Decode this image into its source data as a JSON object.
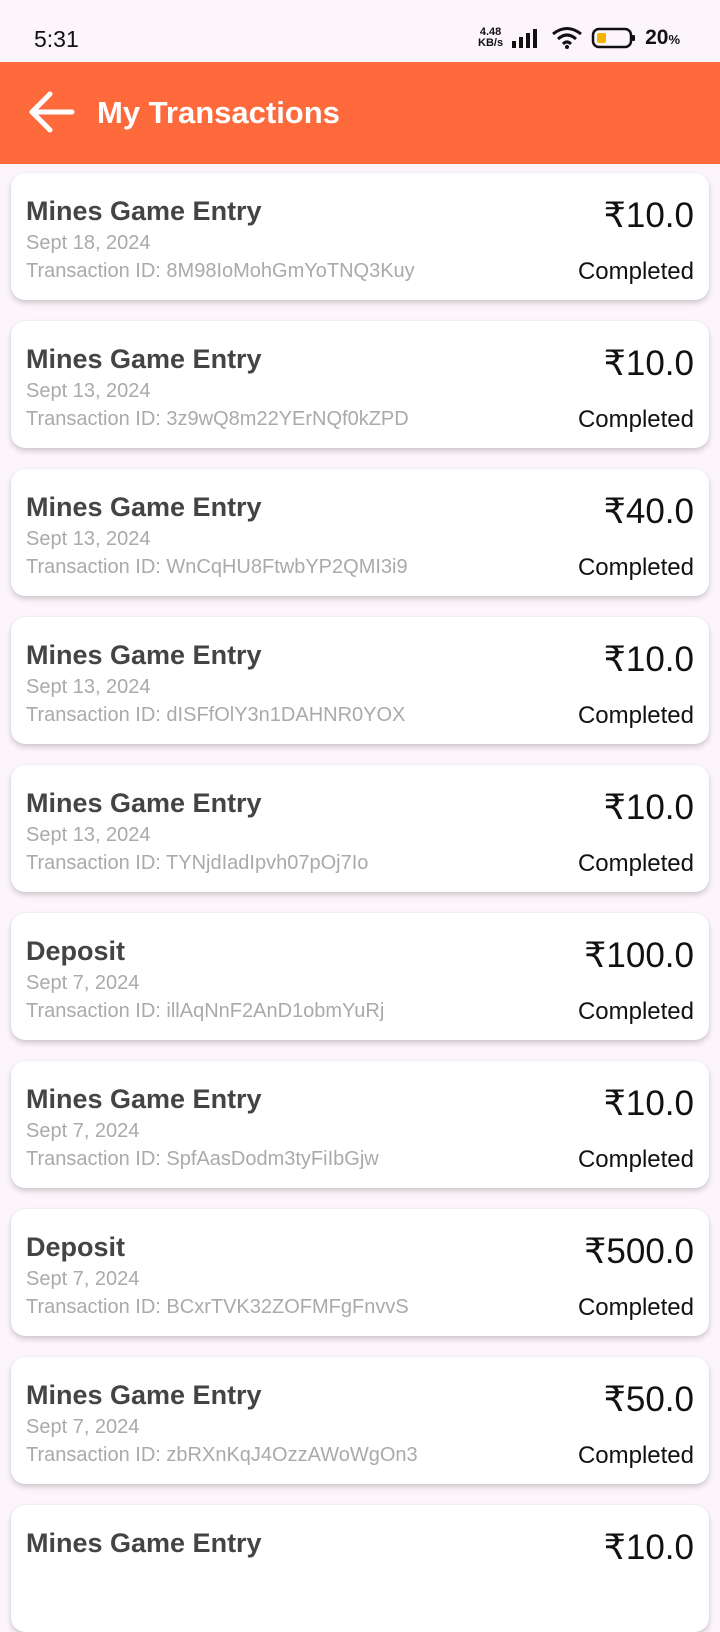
{
  "status_bar": {
    "time": "5:31",
    "net_speed_value": "4.48",
    "net_speed_unit": "KB/s",
    "battery_percent": "20",
    "battery_unit": "%",
    "icons": [
      "signal-icon",
      "wifi-icon",
      "battery-icon"
    ]
  },
  "app_bar": {
    "title": "My Transactions",
    "back_icon": "arrow-left-icon",
    "color": "#ff6a3d"
  },
  "transactions": [
    {
      "title": "Mines Game Entry",
      "date": "Sept 18, 2024",
      "txid": "Transaction ID: 8M98IoMohGmYoTNQ3Kuy",
      "amount": "₹10.0",
      "status": "Completed"
    },
    {
      "title": "Mines Game Entry",
      "date": "Sept 13, 2024",
      "txid": "Transaction ID: 3z9wQ8m22YErNQf0kZPD",
      "amount": "₹10.0",
      "status": "Completed"
    },
    {
      "title": "Mines Game Entry",
      "date": "Sept 13, 2024",
      "txid": "Transaction ID: WnCqHU8FtwbYP2QMI3i9",
      "amount": "₹40.0",
      "status": "Completed"
    },
    {
      "title": "Mines Game Entry",
      "date": "Sept 13, 2024",
      "txid": "Transaction ID: dISFfOlY3n1DAHNR0YOX",
      "amount": "₹10.0",
      "status": "Completed"
    },
    {
      "title": "Mines Game Entry",
      "date": "Sept 13, 2024",
      "txid": "Transaction ID: TYNjdIadIpvh07pOj7Io",
      "amount": "₹10.0",
      "status": "Completed"
    },
    {
      "title": "Deposit",
      "date": "Sept 7, 2024",
      "txid": "Transaction ID: illAqNnF2AnD1obmYuRj",
      "amount": "₹100.0",
      "status": "Completed"
    },
    {
      "title": "Mines Game Entry",
      "date": "Sept 7, 2024",
      "txid": "Transaction ID: SpfAasDodm3tyFiIbGjw",
      "amount": "₹10.0",
      "status": "Completed"
    },
    {
      "title": "Deposit",
      "date": "Sept 7, 2024",
      "txid": "Transaction ID: BCxrTVK32ZOFMFgFnvvS",
      "amount": "₹500.0",
      "status": "Completed"
    },
    {
      "title": "Mines Game Entry",
      "date": "Sept 7, 2024",
      "txid": "Transaction ID: zbRXnKqJ4OzzAWoWgOn3",
      "amount": "₹50.0",
      "status": "Completed"
    },
    {
      "title": "Mines Game Entry",
      "date": "",
      "txid": "",
      "amount": "₹10.0",
      "status": ""
    }
  ]
}
